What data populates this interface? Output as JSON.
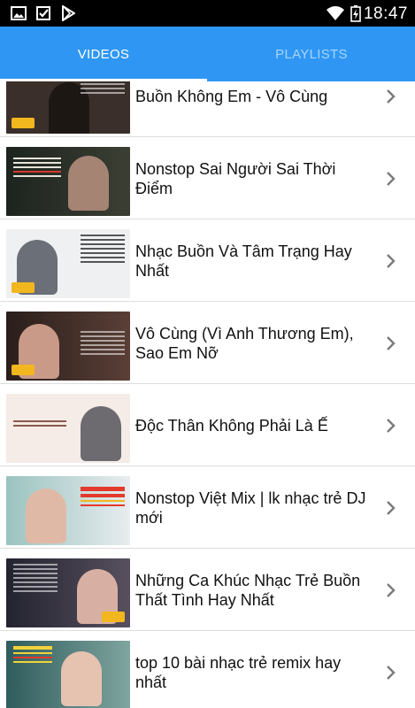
{
  "status_bar": {
    "time": "18:47",
    "icons": [
      "image-icon",
      "download-icon",
      "play-store-icon",
      "wifi-icon",
      "battery-charging-icon"
    ]
  },
  "tabs": [
    {
      "label": "VIDEOS",
      "selected": true
    },
    {
      "label": "PLAYLISTS",
      "selected": false
    }
  ],
  "colors": {
    "tab_bar": "#2f97f3",
    "tab_active": "#ffffff",
    "tab_inactive": "#a9d4fb"
  },
  "videos": [
    {
      "title": "Buồn Không Em - Vô Cùng",
      "thumb": "#3a2f2a"
    },
    {
      "title": "Nonstop Sai Người Sai Thời Điểm",
      "thumb": "#262a22"
    },
    {
      "title": "Nhạc Buồn Và Tâm Trạng Hay Nhất",
      "thumb": "#e9ecef"
    },
    {
      "title": "Vô Cùng (Vì Anh Thương Em), Sao Em Nỡ",
      "thumb": "#3a2a26"
    },
    {
      "title": "Độc Thân Không Phải Là Ế",
      "thumb": "#f3e7e3"
    },
    {
      "title": " Nonstop Việt Mix | lk nhạc trẻ DJ mới",
      "thumb": "#9ac3bf"
    },
    {
      "title": "Những Ca Khúc Nhạc Trẻ Buồn Thất Tình Hay Nhất",
      "thumb": "#2b2c3a"
    },
    {
      "title": "top 10 bài nhạc trẻ remix hay nhất",
      "thumb": "#3b6a6a"
    }
  ]
}
